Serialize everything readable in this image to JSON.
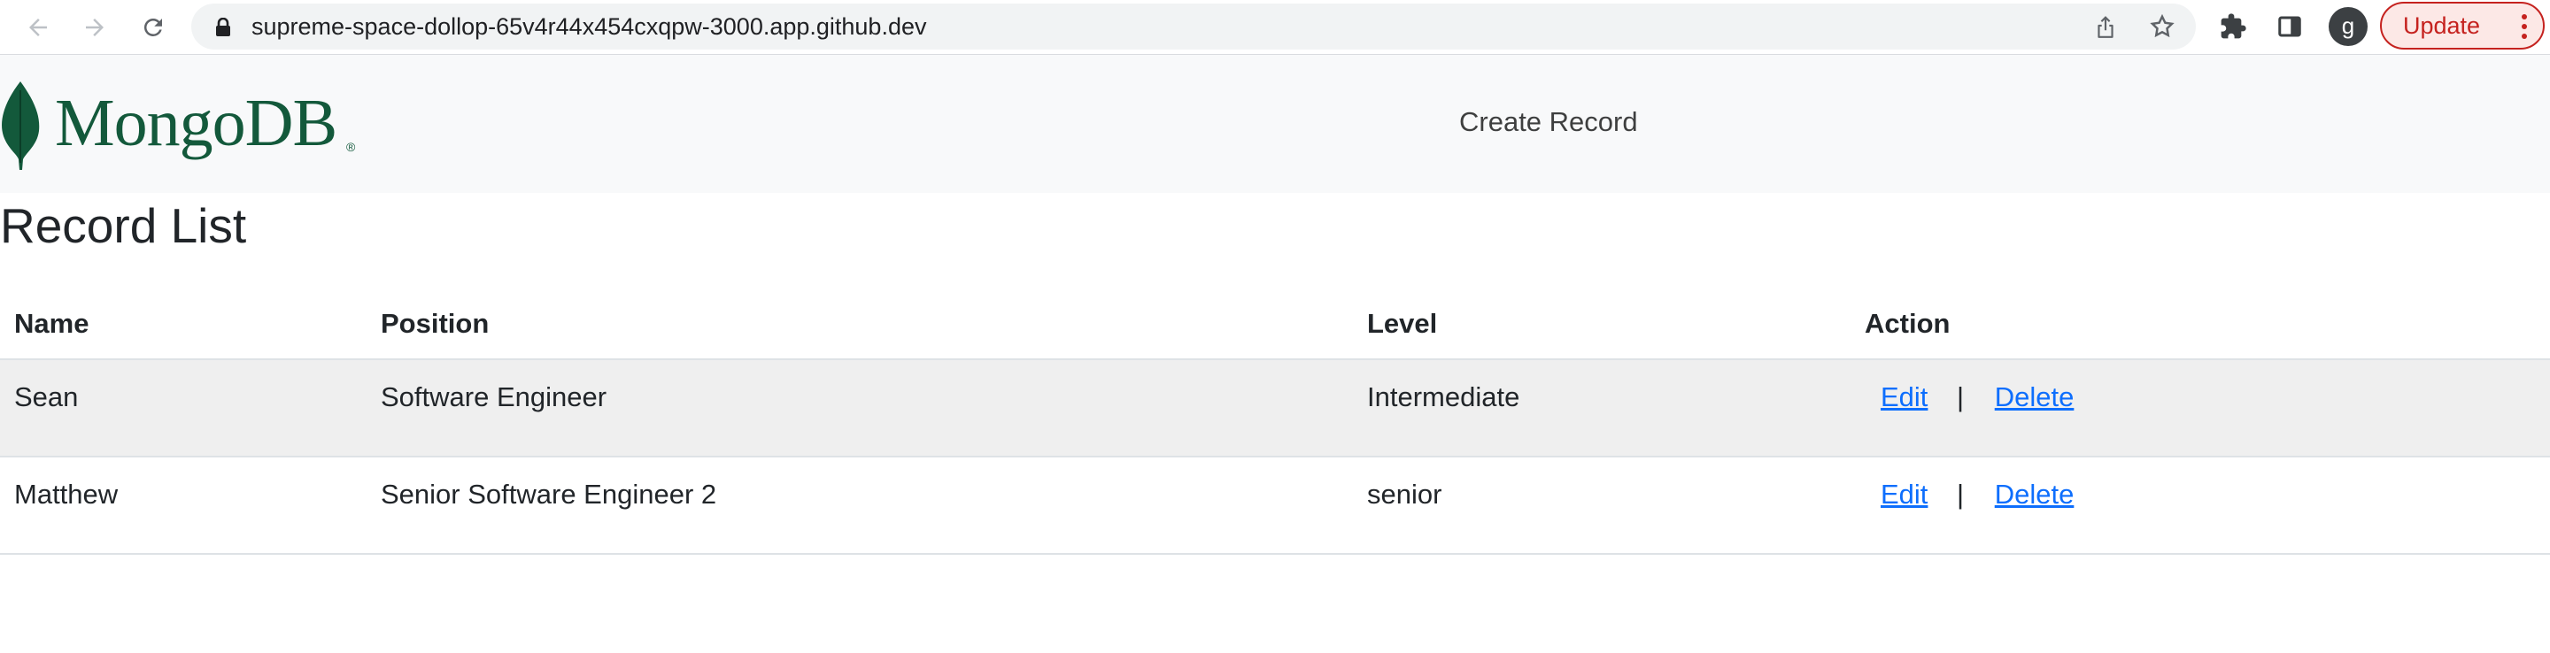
{
  "browser": {
    "url": "supreme-space-dollop-65v4r44x454cxqpw-3000.app.github.dev",
    "profile_initial": "g",
    "update_label": "Update",
    "icons": [
      "back-icon",
      "forward-icon",
      "reload-icon",
      "lock-icon",
      "share-icon",
      "star-icon",
      "extensions-icon",
      "side-panel-icon",
      "more-icon"
    ]
  },
  "navbar": {
    "logo_text": "MongoDB",
    "logo_reg": "®",
    "create_link": "Create Record",
    "brand_color": "#13593b"
  },
  "page": {
    "title": "Record List"
  },
  "table": {
    "headers": {
      "name": "Name",
      "position": "Position",
      "level": "Level",
      "action": "Action"
    },
    "rows": [
      {
        "name": "Sean",
        "position": "Software Engineer",
        "level": "Intermediate",
        "edit": "Edit",
        "separator": "|",
        "delete": "Delete"
      },
      {
        "name": "Matthew",
        "position": "Senior Software Engineer 2",
        "level": "senior",
        "edit": "Edit",
        "separator": "|",
        "delete": "Delete"
      }
    ]
  },
  "colors": {
    "link": "#0d6efd",
    "update": "#c5221f",
    "row_stripe": "#efefef"
  }
}
